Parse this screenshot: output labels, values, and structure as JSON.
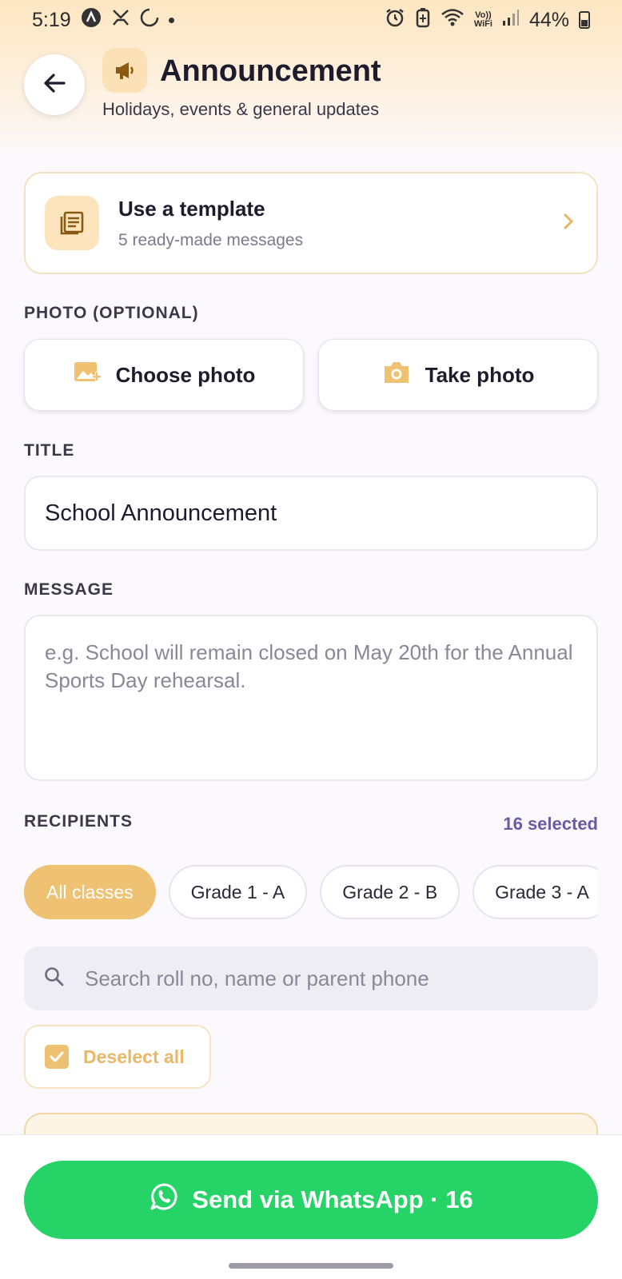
{
  "status_bar": {
    "time": "5:19",
    "volte_top": "Vo))",
    "volte_bottom": "WiFi",
    "battery": "44%"
  },
  "header": {
    "title": "Announcement",
    "subtitle": "Holidays, events & general updates",
    "icon": "megaphone-icon"
  },
  "template": {
    "title": "Use a template",
    "subtitle": "5 ready-made messages"
  },
  "photo": {
    "label": "PHOTO (OPTIONAL)",
    "choose_label": "Choose photo",
    "take_label": "Take photo"
  },
  "title_field": {
    "label": "TITLE",
    "value": "School Announcement"
  },
  "message_field": {
    "label": "MESSAGE",
    "placeholder": "e.g. School will remain closed on May 20th for the Annual Sports Day rehearsal."
  },
  "recipients": {
    "label": "RECIPIENTS",
    "count_text": "16 selected",
    "chips": [
      "All classes",
      "Grade 1 - A",
      "Grade 2 - B",
      "Grade 3 - A"
    ],
    "search_placeholder": "Search roll no, name or parent phone",
    "deselect_label": "Deselect all"
  },
  "send": {
    "label": "Send via WhatsApp · 16"
  },
  "colors": {
    "accent": "#eec173",
    "whatsapp_green": "#25d366",
    "count_purple": "#6a5aa6"
  }
}
